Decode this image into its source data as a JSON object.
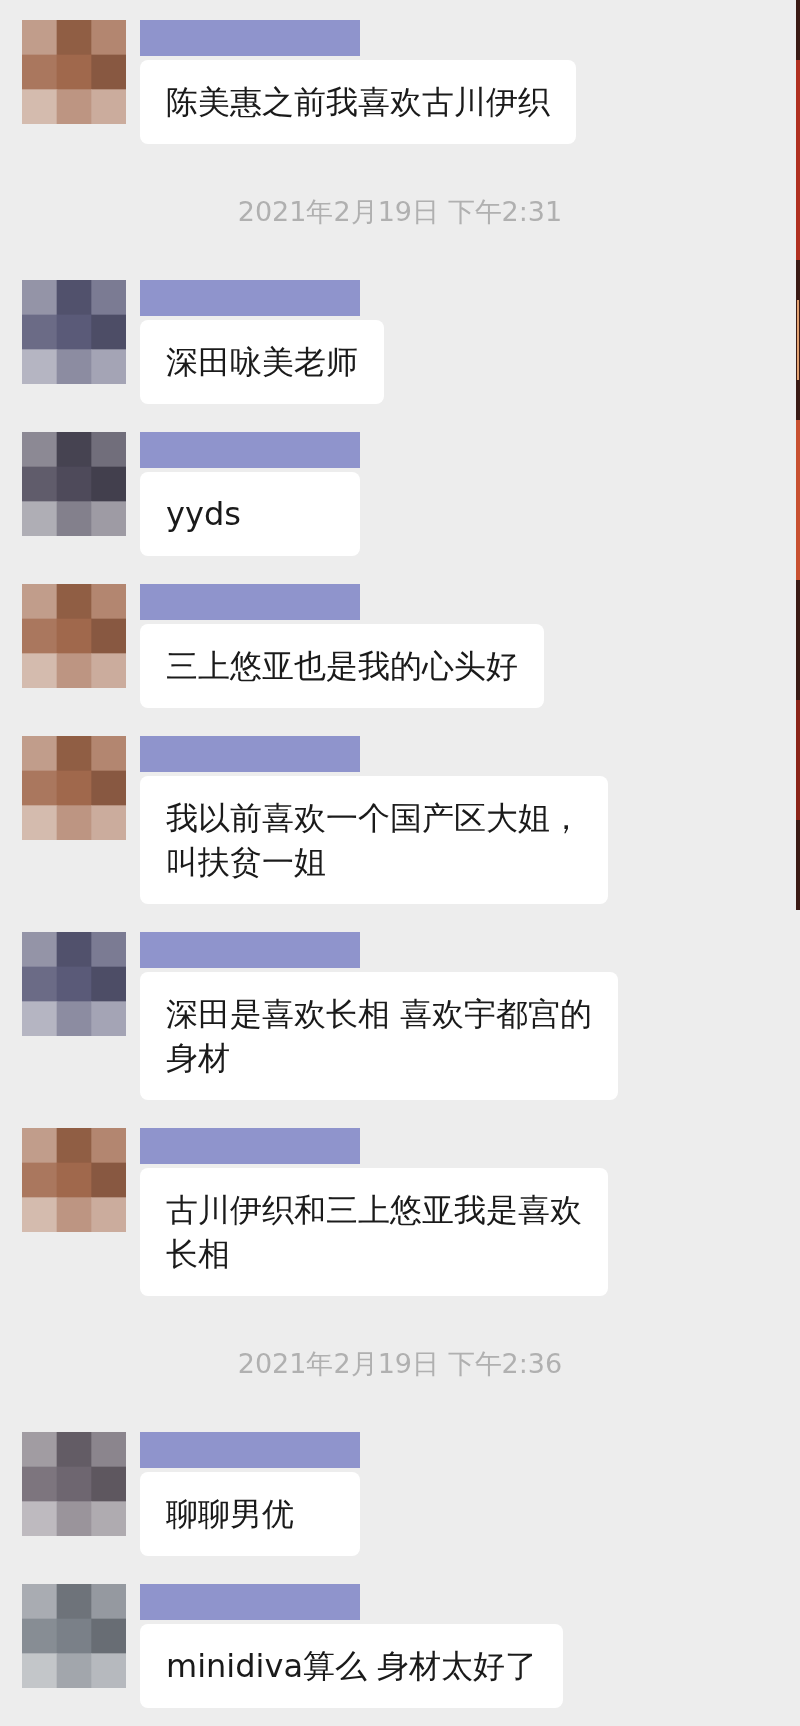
{
  "messages": [
    {
      "kind": "message",
      "color": "#a0684c",
      "lines": [
        "陈美惠之前我喜欢古川伊织"
      ]
    },
    {
      "kind": "timestamp",
      "text": "2021年2月19日 下午2:31"
    },
    {
      "kind": "message",
      "color": "#5a5a78",
      "lines": [
        "深田咏美老师"
      ]
    },
    {
      "kind": "message",
      "color": "#4e4a5a",
      "lines": [
        "yyds"
      ]
    },
    {
      "kind": "message",
      "color": "#a0684c",
      "lines": [
        "三上悠亚也是我的心头好"
      ]
    },
    {
      "kind": "message",
      "color": "#a0684c",
      "lines": [
        "我以前喜欢一个国产区大姐，",
        "叫扶贫一姐"
      ]
    },
    {
      "kind": "message",
      "color": "#5a5a78",
      "lines": [
        "深田是喜欢长相 喜欢宇都宫的",
        "身材"
      ]
    },
    {
      "kind": "message",
      "color": "#a0684c",
      "lines": [
        "古川伊织和三上悠亚我是喜欢",
        "长相"
      ]
    },
    {
      "kind": "timestamp",
      "text": "2021年2月19日 下午2:36"
    },
    {
      "kind": "message",
      "color": "#6e6670",
      "lines": [
        "聊聊男优"
      ]
    },
    {
      "kind": "message",
      "color": "#7a8088",
      "lines": [
        "minidiva算么 身材太好了"
      ]
    }
  ]
}
